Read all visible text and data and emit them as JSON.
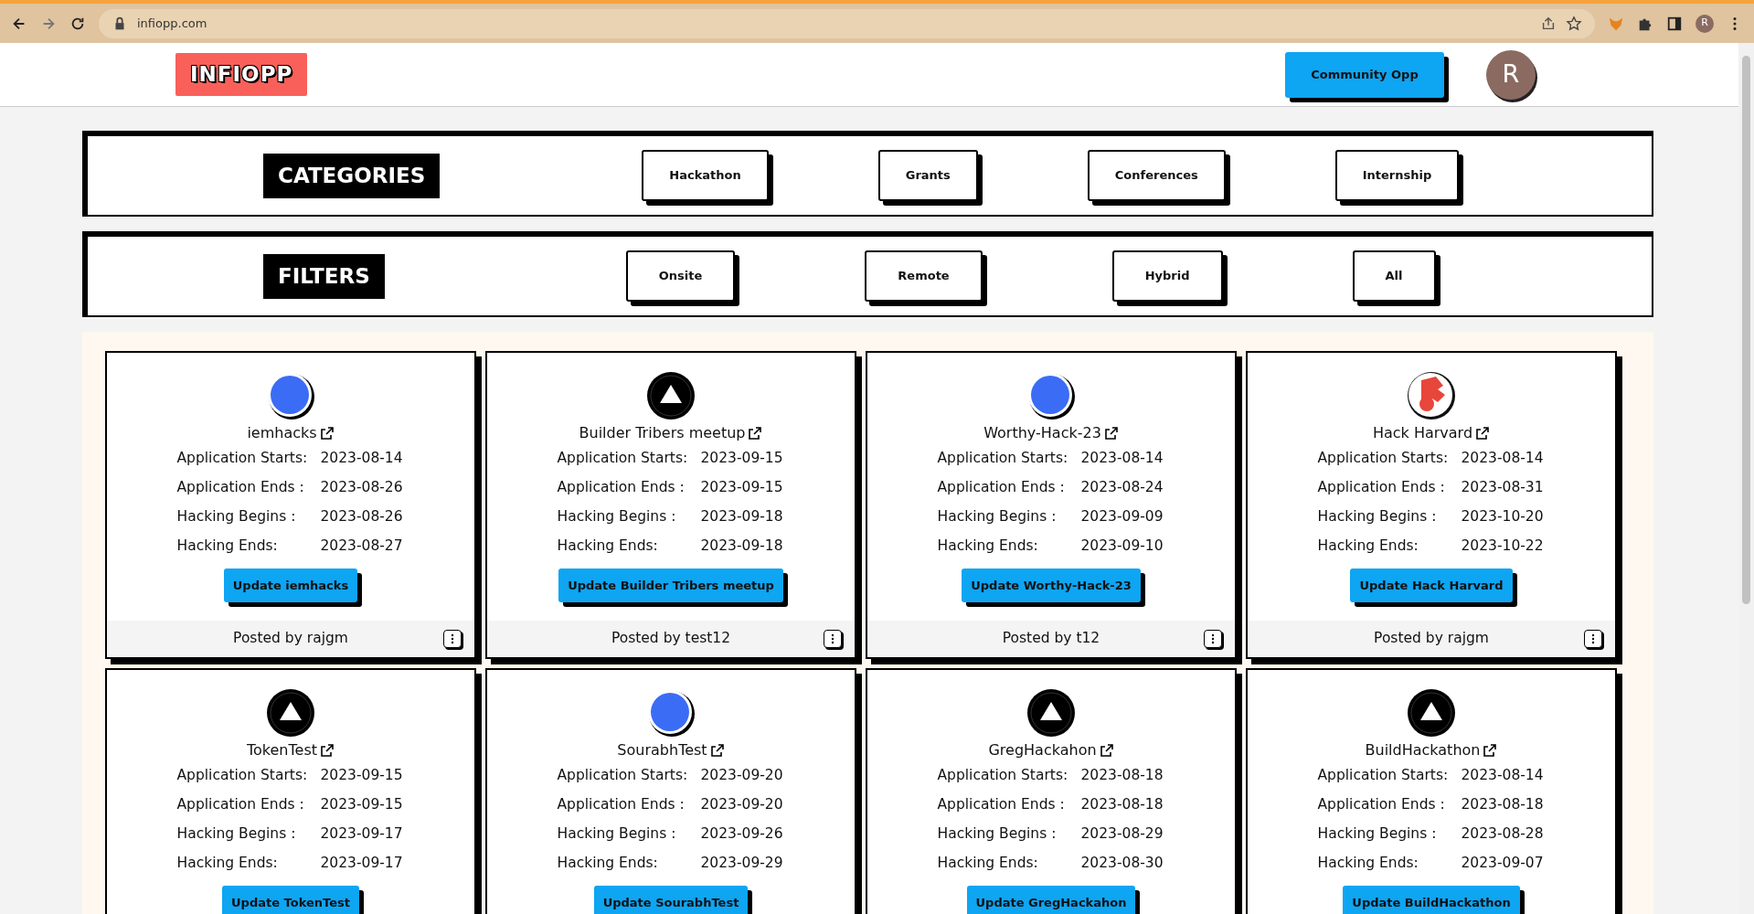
{
  "browser": {
    "address": "infiopp.com",
    "profile": "R"
  },
  "header": {
    "logo": "INFIOPP",
    "button": "Community Opp",
    "avatar": "R"
  },
  "categories": {
    "title": "CATEGORIES",
    "items": [
      "Hackathon",
      "Grants",
      "Conferences",
      "Internship"
    ]
  },
  "filters": {
    "title": "FILTERS",
    "items": [
      "Onsite",
      "Remote",
      "Hybrid",
      "All"
    ]
  },
  "cards": [
    {
      "kind": "blue",
      "name": "iemhacks",
      "rows": [
        {
          "label": "Application Starts:",
          "value": "2023-08-14"
        },
        {
          "label": "Application Ends :",
          "value": "2023-08-26"
        },
        {
          "label": "Hacking Begins :",
          "value": "2023-08-26"
        },
        {
          "label": "Hacking Ends:",
          "value": "2023-08-27"
        }
      ],
      "button": "Update iemhacks",
      "posted": "Posted by rajgm"
    },
    {
      "kind": "triangle",
      "name": "Builder Tribers meetup",
      "rows": [
        {
          "label": "Application Starts:",
          "value": "2023-09-15"
        },
        {
          "label": "Application Ends :",
          "value": "2023-09-15"
        },
        {
          "label": "Hacking Begins :",
          "value": "2023-09-18"
        },
        {
          "label": "Hacking Ends:",
          "value": "2023-09-18"
        }
      ],
      "button": "Update Builder Tribers meetup",
      "posted": "Posted by test12"
    },
    {
      "kind": "blue",
      "name": "Worthy-Hack-23",
      "rows": [
        {
          "label": "Application Starts:",
          "value": "2023-08-14"
        },
        {
          "label": "Application Ends :",
          "value": "2023-08-24"
        },
        {
          "label": "Hacking Begins :",
          "value": "2023-09-09"
        },
        {
          "label": "Hacking Ends:",
          "value": "2023-09-10"
        }
      ],
      "button": "Update Worthy-Hack-23",
      "posted": "Posted by t12"
    },
    {
      "kind": "crest",
      "name": "Hack Harvard",
      "rows": [
        {
          "label": "Application Starts:",
          "value": "2023-08-14"
        },
        {
          "label": "Application Ends :",
          "value": "2023-08-31"
        },
        {
          "label": "Hacking Begins :",
          "value": "2023-10-20"
        },
        {
          "label": "Hacking Ends:",
          "value": "2023-10-22"
        }
      ],
      "button": "Update Hack Harvard",
      "posted": "Posted by rajgm"
    },
    {
      "kind": "triangle",
      "name": "TokenTest",
      "rows": [
        {
          "label": "Application Starts:",
          "value": "2023-09-15"
        },
        {
          "label": "Application Ends :",
          "value": "2023-09-15"
        },
        {
          "label": "Hacking Begins :",
          "value": "2023-09-17"
        },
        {
          "label": "Hacking Ends:",
          "value": "2023-09-17"
        }
      ],
      "button": "Update TokenTest"
    },
    {
      "kind": "blue",
      "name": "SourabhTest",
      "rows": [
        {
          "label": "Application Starts:",
          "value": "2023-09-20"
        },
        {
          "label": "Application Ends :",
          "value": "2023-09-20"
        },
        {
          "label": "Hacking Begins :",
          "value": "2023-09-26"
        },
        {
          "label": "Hacking Ends:",
          "value": "2023-09-29"
        }
      ],
      "button": "Update SourabhTest"
    },
    {
      "kind": "triangle",
      "name": "GregHackahon",
      "rows": [
        {
          "label": "Application Starts:",
          "value": "2023-08-18"
        },
        {
          "label": "Application Ends :",
          "value": "2023-08-18"
        },
        {
          "label": "Hacking Begins :",
          "value": "2023-08-29"
        },
        {
          "label": "Hacking Ends:",
          "value": "2023-08-30"
        }
      ],
      "button": "Update GregHackahon"
    },
    {
      "kind": "triangle",
      "name": "BuildHackathon",
      "rows": [
        {
          "label": "Application Starts:",
          "value": "2023-08-14"
        },
        {
          "label": "Application Ends :",
          "value": "2023-08-18"
        },
        {
          "label": "Hacking Begins :",
          "value": "2023-08-28"
        },
        {
          "label": "Hacking Ends:",
          "value": "2023-09-07"
        }
      ],
      "button": "Update BuildHackathon"
    }
  ]
}
